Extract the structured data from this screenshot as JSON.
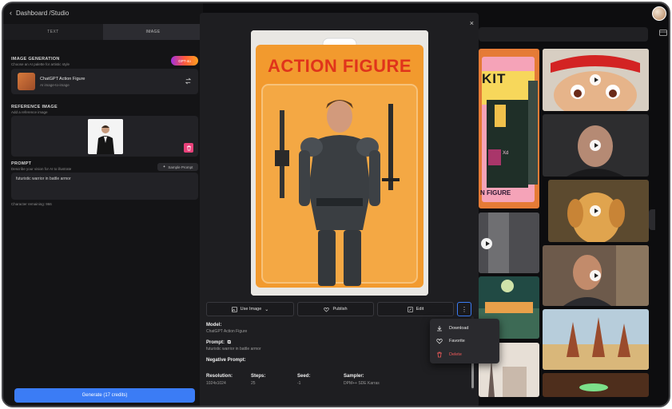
{
  "header": {
    "breadcrumb": "Dashboard /Studio"
  },
  "left_panel": {
    "tabs": [
      {
        "label": "TEXT"
      },
      {
        "label": "IMAGE"
      }
    ],
    "image_generation": {
      "title": "IMAGE GENERATION",
      "subtitle": "Choose an AI palette for artistic style",
      "badge": "GPT-4o",
      "model_name": "ChatGPT Action Figure",
      "model_sub": "AI image-to-image"
    },
    "reference_image": {
      "title": "REFERENCE IMAGE",
      "subtitle": "Add a reference image"
    },
    "prompt": {
      "title": "PROMPT",
      "subtitle": "Describe your vision for AI to illustrate",
      "sample_button": "Sample Prompt",
      "value": "futuristic warrior in battle armor",
      "char_remaining": "Character remaining: 966"
    },
    "generate_button": "Generate (17 credits)"
  },
  "modal": {
    "hero_title": "ACTION FIGURE",
    "actions": {
      "use_image": "Use Image",
      "publish": "Publish",
      "edit": "Edit",
      "more": "⋮"
    },
    "model_label": "Model:",
    "model_value": "ChatGPT Action Figure",
    "prompt_label": "Prompt:",
    "prompt_value": "futuristic warrior in battle armor",
    "negative_prompt_label": "Negative Prompt:",
    "meta": [
      {
        "label": "Resolution:",
        "value": "1024x1024"
      },
      {
        "label": "Steps:",
        "value": "25"
      },
      {
        "label": "Seed:",
        "value": "-1"
      },
      {
        "label": "Sampler:",
        "value": "DPM++ SDE Karras"
      }
    ],
    "close": "×"
  },
  "dropdown": {
    "items": [
      {
        "label": "Download",
        "icon": "download-icon"
      },
      {
        "label": "Favorite",
        "icon": "heart-icon"
      },
      {
        "label": "Delete",
        "icon": "trash-icon",
        "danger": true
      }
    ]
  },
  "gallery": {
    "kit_text": "KIT",
    "kit_footer": "N FIGURE",
    "kit_badge": "Xd"
  },
  "colors": {
    "accent": "#3b7cf5",
    "danger": "#f05a5a",
    "delete_button": "#e8417a",
    "hero_card": "#f29a2e",
    "hero_title": "#e0341b"
  }
}
